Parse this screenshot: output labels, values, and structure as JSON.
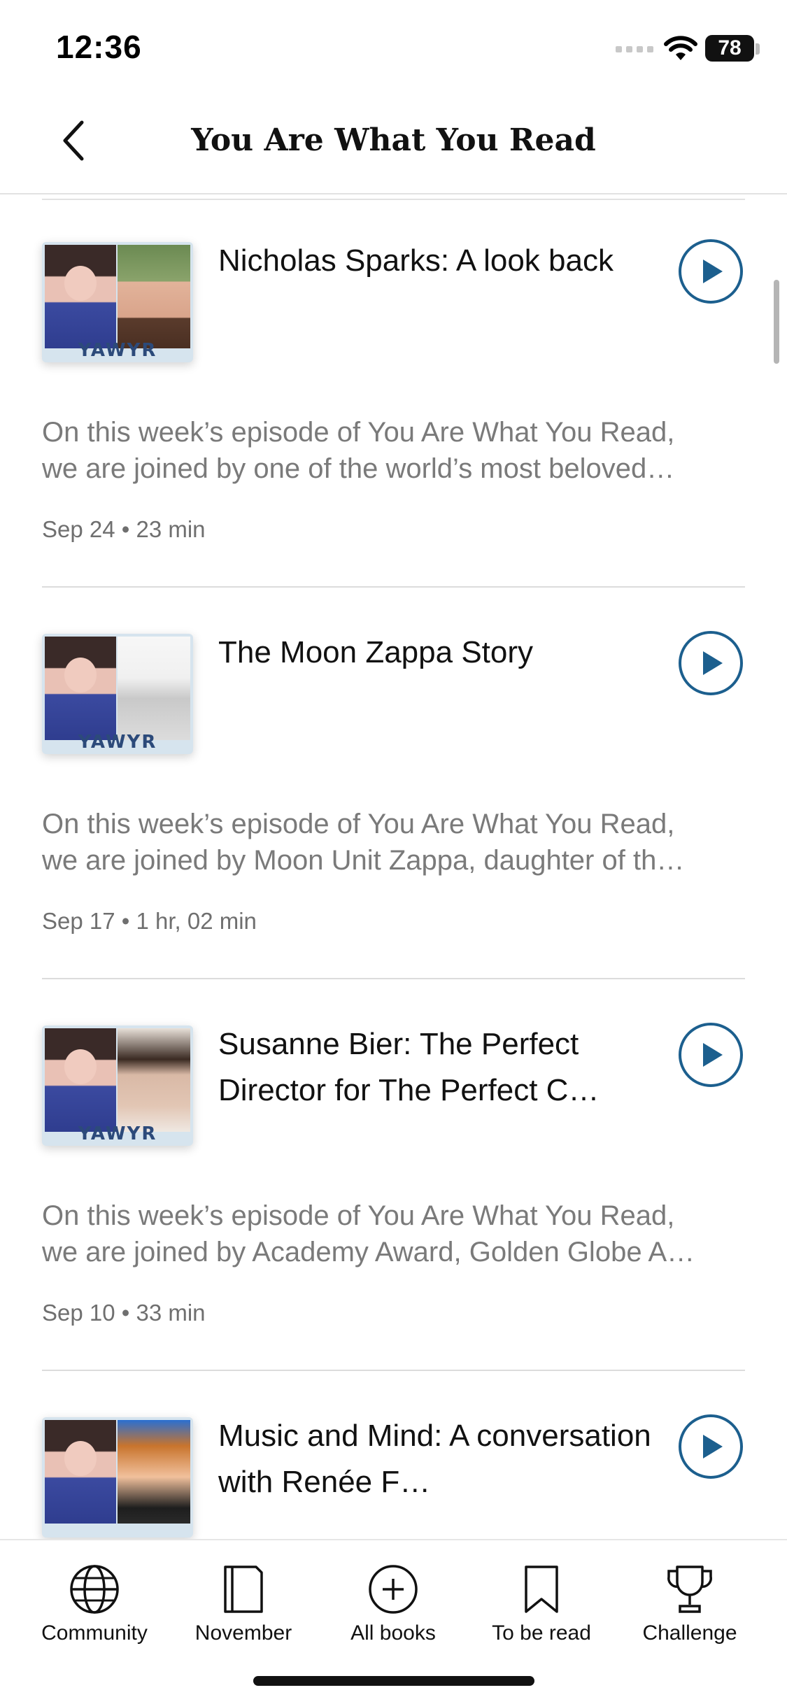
{
  "status_bar": {
    "time": "12:36",
    "battery": "78"
  },
  "header": {
    "title": "You Are What You Read"
  },
  "episodes": [
    {
      "title": "Nicholas Sparks: A look back",
      "cover_label": "YAWYR",
      "desc_line1": "On this week’s episode of You Are What You Read,",
      "desc_line2": "we are joined by one of the world’s most beloved…",
      "meta": "Sep 24 • 23 min"
    },
    {
      "title": "The Moon Zappa Story",
      "cover_label": "YAWYR",
      "desc_line1": "On this week’s episode of You Are What You Read,",
      "desc_line2": "we are joined by Moon Unit Zappa, daughter of th…",
      "meta": "Sep 17 • 1  hr, 02 min"
    },
    {
      "title": "Susanne Bier: The Perfect Director for The Perfect C…",
      "cover_label": "YAWYR",
      "desc_line1": "On this week’s episode of You Are What You Read,",
      "desc_line2": "we are joined by Academy Award, Golden Globe A…",
      "meta": "Sep 10 • 33 min"
    },
    {
      "title": "Music and Mind: A conversation with Renée F…",
      "cover_label": "",
      "desc_line1": "",
      "desc_line2": "",
      "meta": ""
    }
  ],
  "tabs": [
    {
      "label": "Community",
      "icon": "globe-icon"
    },
    {
      "label": "November",
      "icon": "book-icon"
    },
    {
      "label": "All books",
      "icon": "plus-circle-icon"
    },
    {
      "label": "To be read",
      "icon": "bookmark-icon"
    },
    {
      "label": "Challenge",
      "icon": "trophy-icon"
    }
  ],
  "colors": {
    "accent": "#1c5f8e",
    "muted_text": "#7a7a7a",
    "divider": "#dcdcdc"
  }
}
